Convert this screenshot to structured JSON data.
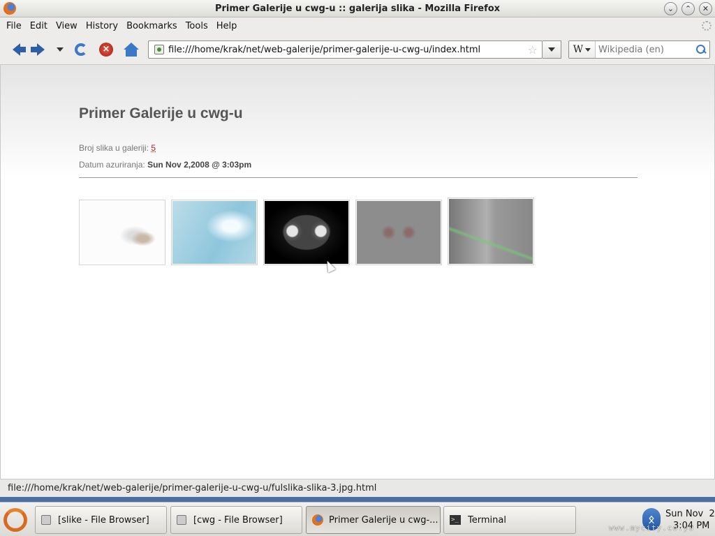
{
  "window": {
    "title": "Primer Galerije u cwg-u :: galerija slika - Mozilla Firefox",
    "buttons": [
      "minimize-icon",
      "maximize-icon",
      "close-icon"
    ]
  },
  "menu": {
    "items": [
      {
        "label": "File"
      },
      {
        "label": "Edit"
      },
      {
        "label": "View"
      },
      {
        "label": "History"
      },
      {
        "label": "Bookmarks"
      },
      {
        "label": "Tools"
      },
      {
        "label": "Help"
      }
    ]
  },
  "toolbar": {
    "url": "file:///home/krak/net/web-galerije/primer-galerije-u-cwg-u/index.html",
    "search_engine": "W",
    "search_placeholder": "Wikipedia (en)"
  },
  "page": {
    "title": "Primer Galerije u cwg-u",
    "count_label": "Broj slika u galeriji:",
    "count_value": "5",
    "updated_label": "Datum azuriranja:",
    "updated_value": "Sun Nov 2,2008 @ 3:03pm",
    "thumbnails": [
      "slika-1",
      "slika-2",
      "slika-3",
      "slika-4",
      "slika-5"
    ]
  },
  "statusbar": {
    "text": "file:///home/krak/net/web-galerije/primer-galerije-u-cwg-u/fulslika-slika-3.jpg.html"
  },
  "taskbar": {
    "tasks": [
      {
        "label": "[slike - File Browser]"
      },
      {
        "label": "[cwg - File Browser]"
      },
      {
        "label": "Primer Galerije u cwg-..."
      },
      {
        "label": "Terminal"
      }
    ],
    "clock_date": "Sun Nov  2",
    "clock_time": "3:04 PM",
    "watermark": "www.mycity.co.yu"
  }
}
